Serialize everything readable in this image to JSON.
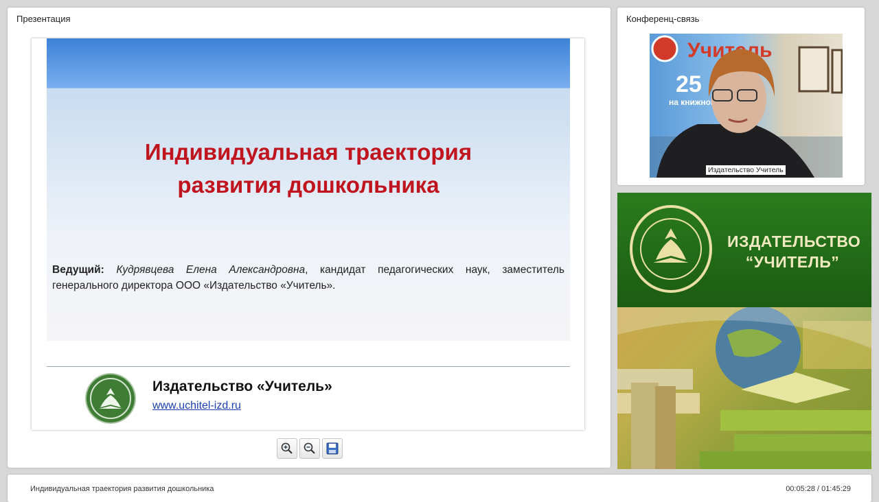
{
  "presentation_panel": {
    "title": "Презентация",
    "slide": {
      "title_line1": "Индивидуальная траектория",
      "title_line2": "развития дошкольника",
      "presenter_label": "Ведущий:",
      "presenter_name": "Кудрявцева Елена Александровна",
      "presenter_description": ", кандидат педагогических наук, заместитель генерального директора ООО «Издательство «Учитель».",
      "publisher_name": "Издательство «Учитель»",
      "publisher_url": "www.uchitel-izd.ru"
    },
    "toolbar": [
      {
        "icon": "zoom-in-icon"
      },
      {
        "icon": "zoom-out-icon"
      },
      {
        "icon": "save-icon"
      }
    ]
  },
  "conference_panel": {
    "title": "Конференц-связь",
    "video_label": "Издательство Учитель",
    "video_backdrop_poster_text": [
      "Учитель",
      "25",
      "на книжном"
    ]
  },
  "promo": {
    "line1": "ИЗДАТЕЛЬСТВО",
    "line2": "“УЧИТЕЛЬ”"
  },
  "status_bar": {
    "title": "Индивидуальная траектория развития дошкольника",
    "time": "00:05:28 / 01:45:29"
  },
  "colors": {
    "slide_title": "#c0151e",
    "brand_green": "#2b7c1e",
    "link_blue": "#1b3fb0"
  }
}
